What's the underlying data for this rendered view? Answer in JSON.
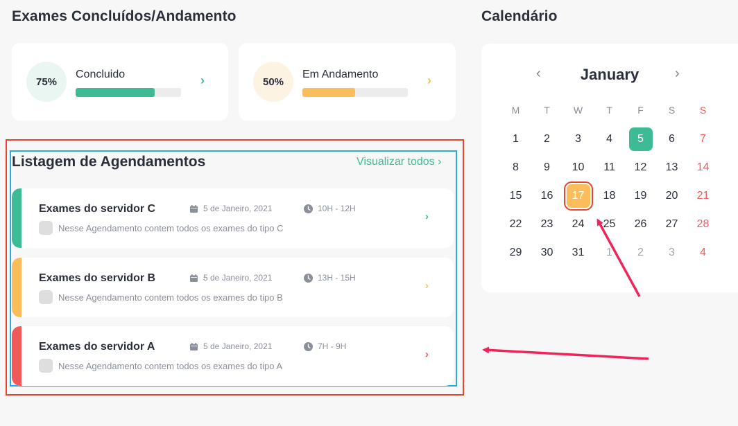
{
  "exams_title": "Exames Concluídos/Andamento",
  "calendar_title": "Calendário",
  "stats": [
    {
      "percent_label": "75%",
      "label": "Concluido",
      "progress": 0.75,
      "color": "#3dbb95"
    },
    {
      "percent_label": "50%",
      "label": "Em Andamento",
      "progress": 0.5,
      "color": "#fbbd5c"
    }
  ],
  "list": {
    "title": "Listagem de Agendamentos",
    "view_all": "Visualizar todos ›"
  },
  "appointments": [
    {
      "title": "Exames do servidor C",
      "date": "5 de Janeiro, 2021",
      "time": "10H - 12H",
      "desc": "Nesse Agendamento contem todos os exames do tipo C",
      "color": "#3dbb95"
    },
    {
      "title": "Exames do servidor B",
      "date": "5 de Janeiro, 2021",
      "time": "13H - 15H",
      "desc": "Nesse Agendamento contem todos os exames do tipo B",
      "color": "#fbbd5c"
    },
    {
      "title": "Exames do servidor A",
      "date": "5 de Janeiro, 2021",
      "time": "7H - 9H",
      "desc": "Nesse Agendamento contem todos os exames do tipo A",
      "color": "#ef5b5b"
    }
  ],
  "calendar": {
    "month": "January",
    "weekdays": [
      "M",
      "T",
      "W",
      "T",
      "F",
      "S",
      "S"
    ],
    "weeks": [
      [
        "1",
        "2",
        "3",
        "4",
        "5",
        "6",
        "7"
      ],
      [
        "8",
        "9",
        "10",
        "11",
        "12",
        "13",
        "14"
      ],
      [
        "15",
        "16",
        "17",
        "18",
        "19",
        "20",
        "21"
      ],
      [
        "22",
        "23",
        "24",
        "25",
        "26",
        "27",
        "28"
      ],
      [
        "29",
        "30",
        "31",
        "1",
        "2",
        "3",
        "4"
      ]
    ],
    "today": "5",
    "selected": "17"
  }
}
